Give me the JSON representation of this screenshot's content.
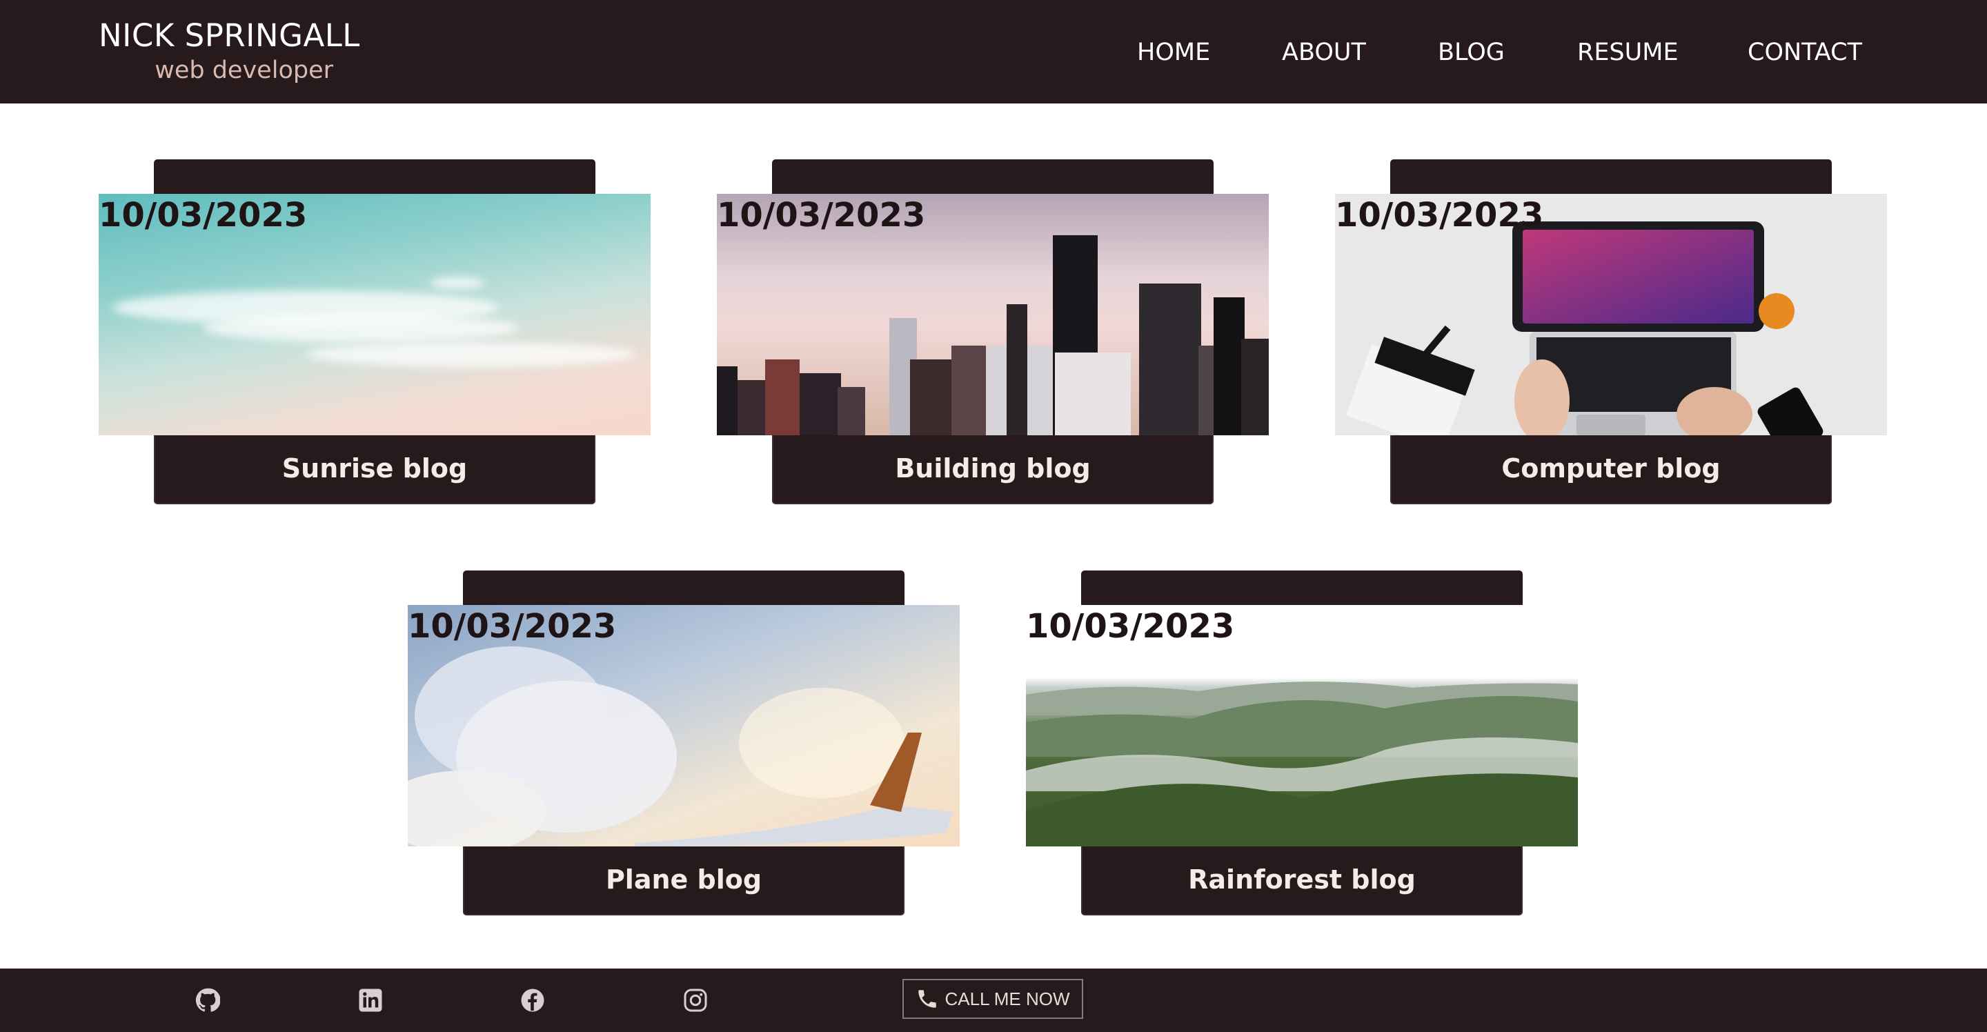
{
  "header": {
    "name": "NICK SPRINGALL",
    "tagline": "web developer",
    "nav": [
      "HOME",
      "ABOUT",
      "BLOG",
      "RESUME",
      "CONTACT"
    ]
  },
  "cards": [
    {
      "date": "10/03/2023",
      "title": "Sunrise blog"
    },
    {
      "date": "10/03/2023",
      "title": "Building blog"
    },
    {
      "date": "10/03/2023",
      "title": "Computer blog"
    },
    {
      "date": "10/03/2023",
      "title": "Plane blog"
    },
    {
      "date": "10/03/2023",
      "title": "Rainforest blog"
    }
  ],
  "footer": {
    "social": [
      "github-icon",
      "linkedin-icon",
      "facebook-icon",
      "instagram-icon"
    ],
    "call_label": "CALL ME NOW"
  },
  "colors": {
    "dark": "#261a1c",
    "tagline": "#d9b9b0",
    "background": "#ffffff"
  }
}
